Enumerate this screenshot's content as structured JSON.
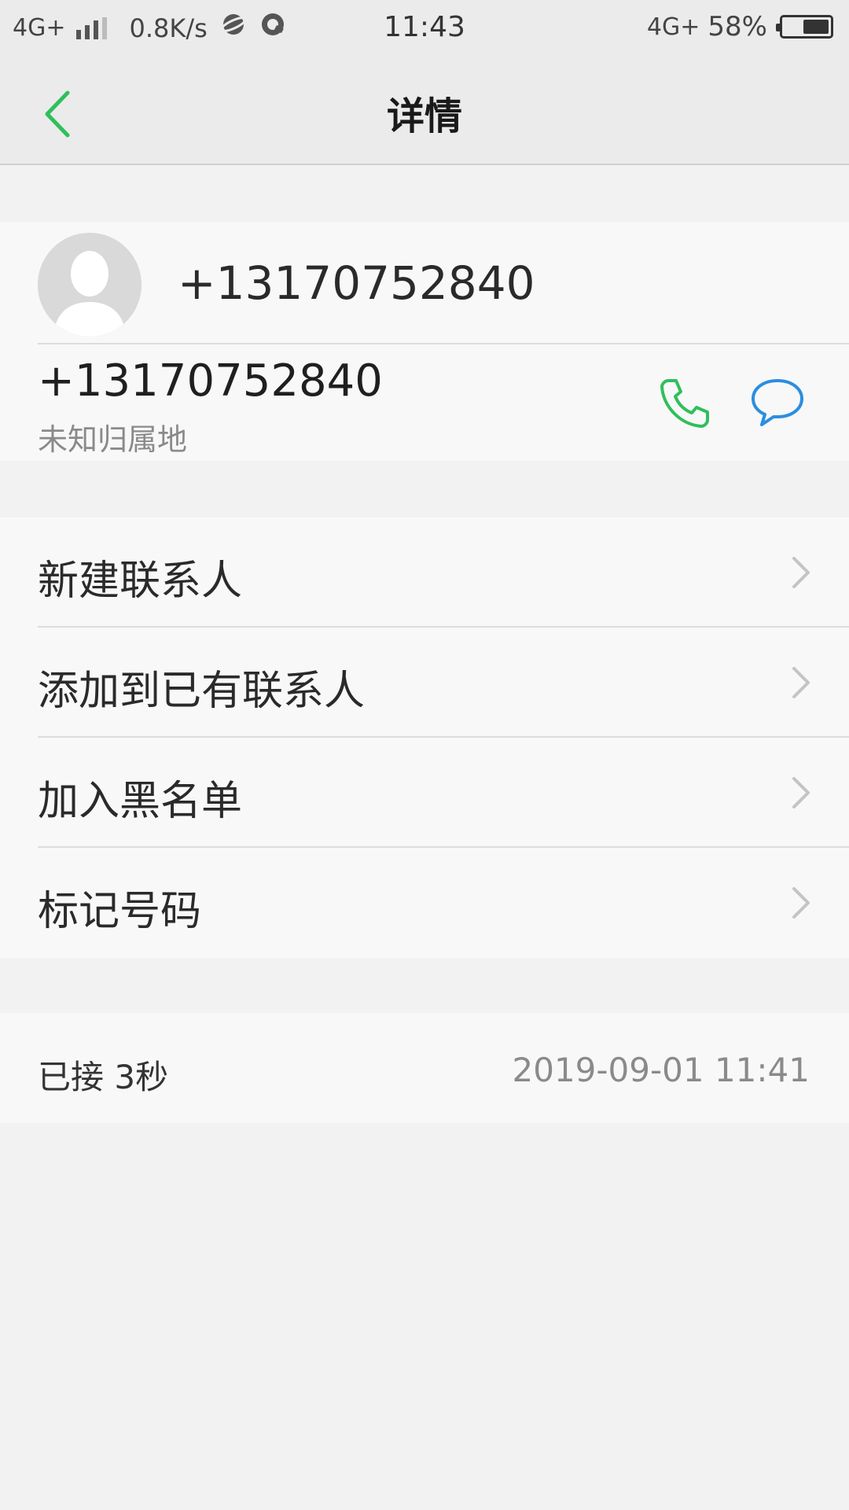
{
  "status_bar": {
    "network": "4G+",
    "speed": "0.8K/s",
    "time": "11:43",
    "network_right": "4G+",
    "battery": "58%",
    "battery_level": 0.58
  },
  "header": {
    "title": "详情",
    "accent_color": "#2fbf5b"
  },
  "contact": {
    "name": "+13170752840",
    "number": "+13170752840",
    "location": "未知归属地",
    "call_icon_color": "#2fbf5b",
    "message_icon_color": "#2b8ee0"
  },
  "actions": [
    {
      "label": "新建联系人",
      "icon": "chevron-right-icon"
    },
    {
      "label": "添加到已有联系人",
      "icon": "chevron-right-icon"
    },
    {
      "label": "加入黑名单",
      "icon": "chevron-right-icon"
    },
    {
      "label": "标记号码",
      "icon": "chevron-right-icon"
    }
  ],
  "call_log": {
    "status": "已接 3秒",
    "datetime": "2019-09-01 11:41"
  }
}
